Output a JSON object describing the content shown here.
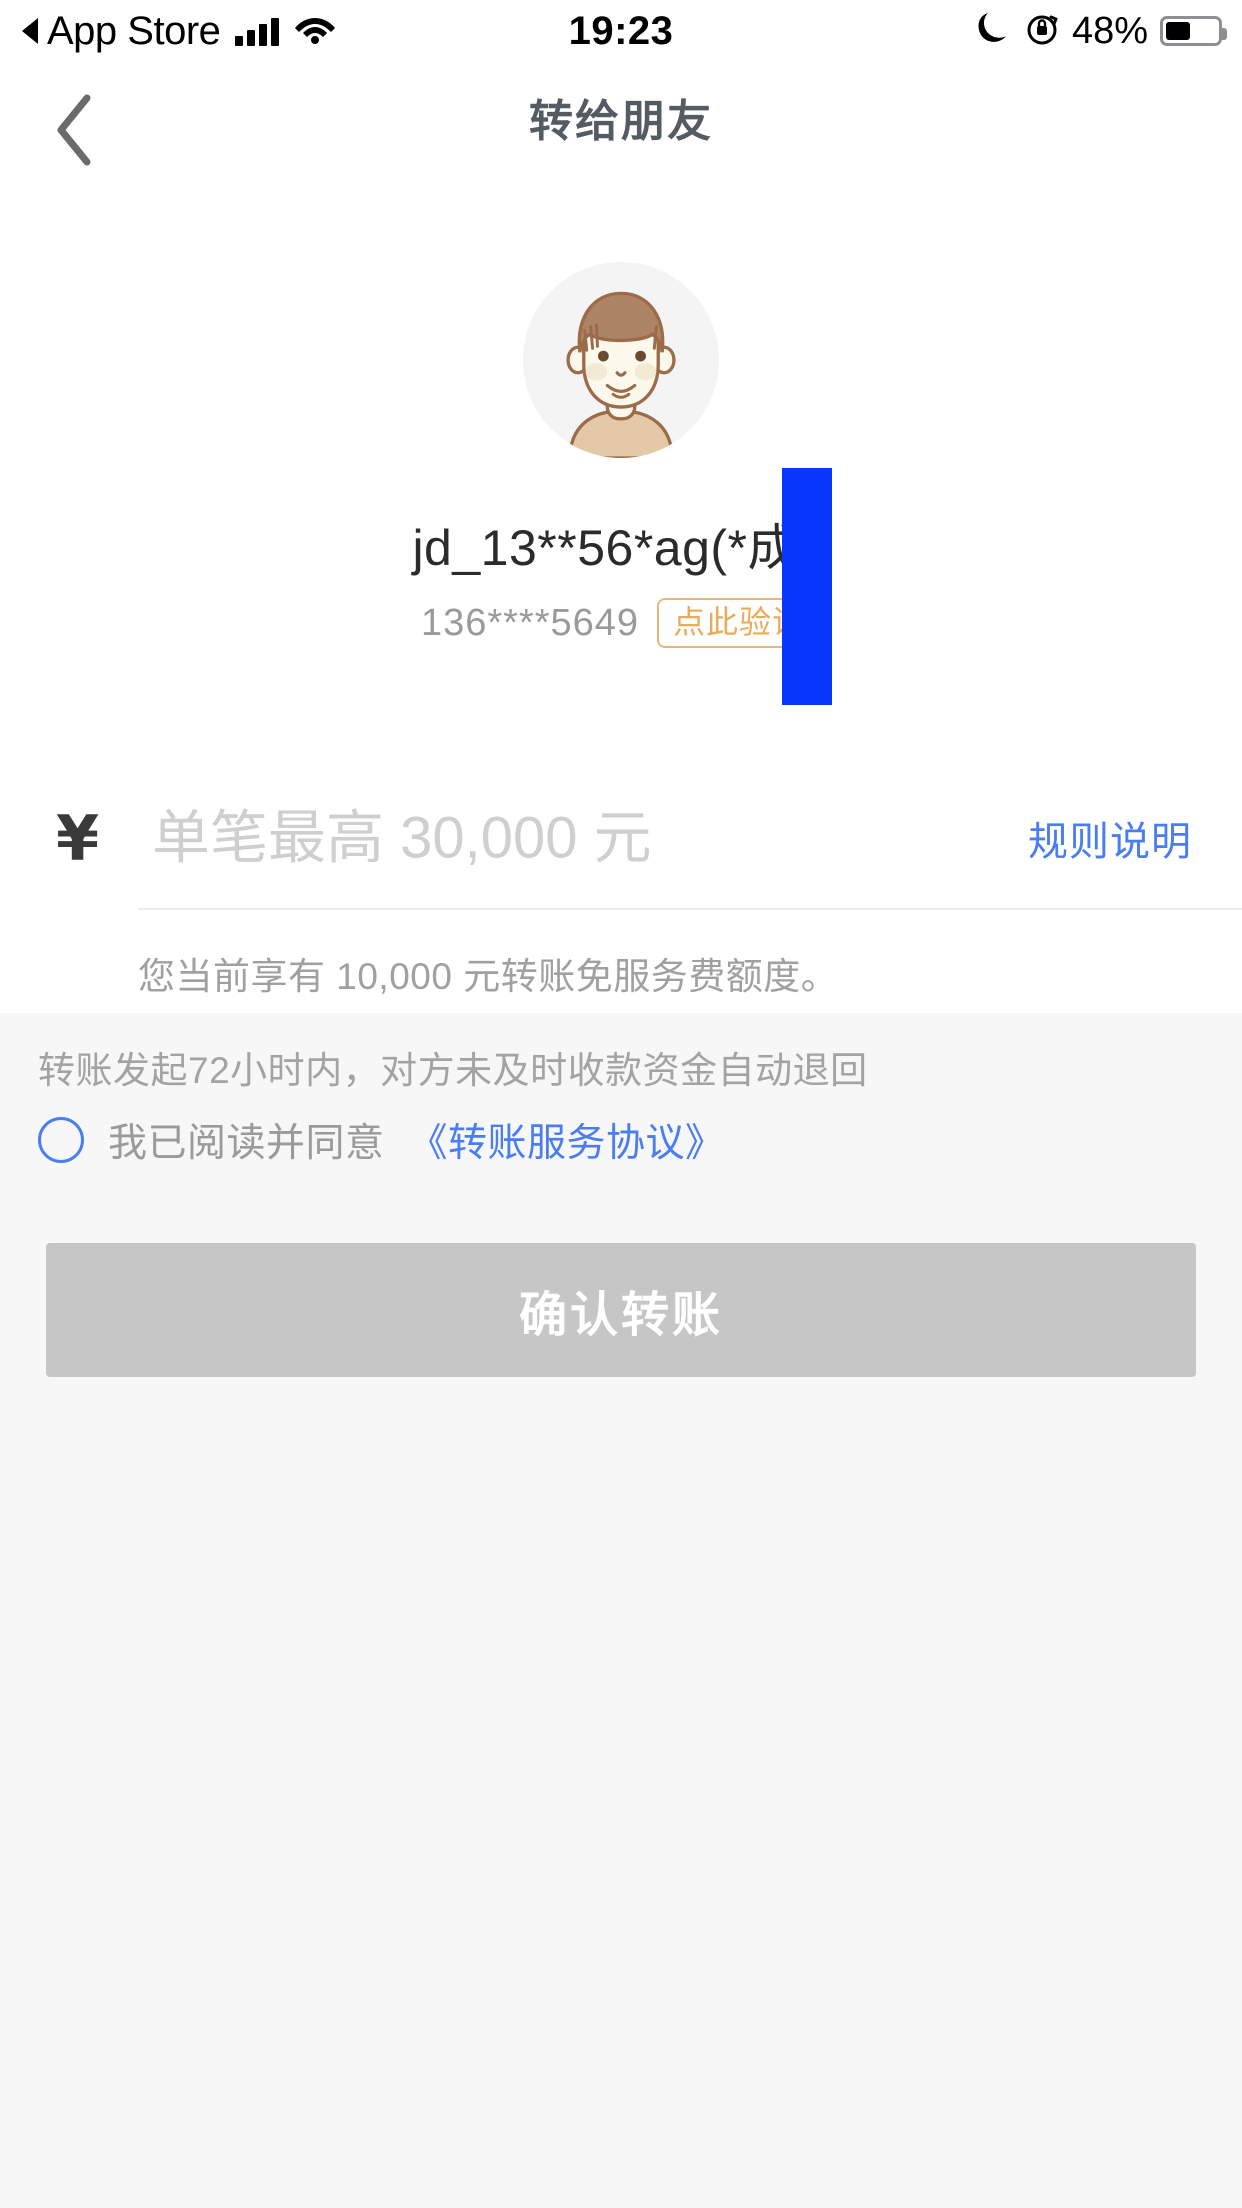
{
  "status_bar": {
    "back_app": "App Store",
    "back_icon": "triangle-left-icon",
    "signal_icon": "cellular-signal-icon",
    "wifi_icon": "wifi-icon",
    "time": "19:23",
    "moon_icon": "do-not-disturb-moon-icon",
    "lock_rotation_icon": "rotation-lock-icon",
    "battery_percent": "48%",
    "battery_icon": "battery-icon"
  },
  "nav": {
    "back_icon": "chevron-left-icon",
    "title": "转给朋友"
  },
  "payee": {
    "avatar_icon": "user-avatar-icon",
    "name": "jd_13**56*ag(*成  )",
    "phone": "136****5649",
    "verify_badge": "点此验证",
    "redaction_color": "#0936fd"
  },
  "amount": {
    "currency_symbol": "¥",
    "value": "",
    "placeholder": "单笔最高 30,000 元",
    "rules_link": "规则说明",
    "fee_note": "您当前享有 10,000 元转账免服务费额度。"
  },
  "footer": {
    "refund_note": "转账发起72小时内，对方未及时收款资金自动退回",
    "agree_checkbox_icon": "radio-unchecked-icon",
    "agree_text": "我已阅读并同意",
    "agreement_link": "《转账服务协议》",
    "confirm_label": "确认转账",
    "accent_color": "#4a7df0",
    "badge_color": "#e8ac5a",
    "confirm_disabled_color": "#c6c6c6"
  }
}
